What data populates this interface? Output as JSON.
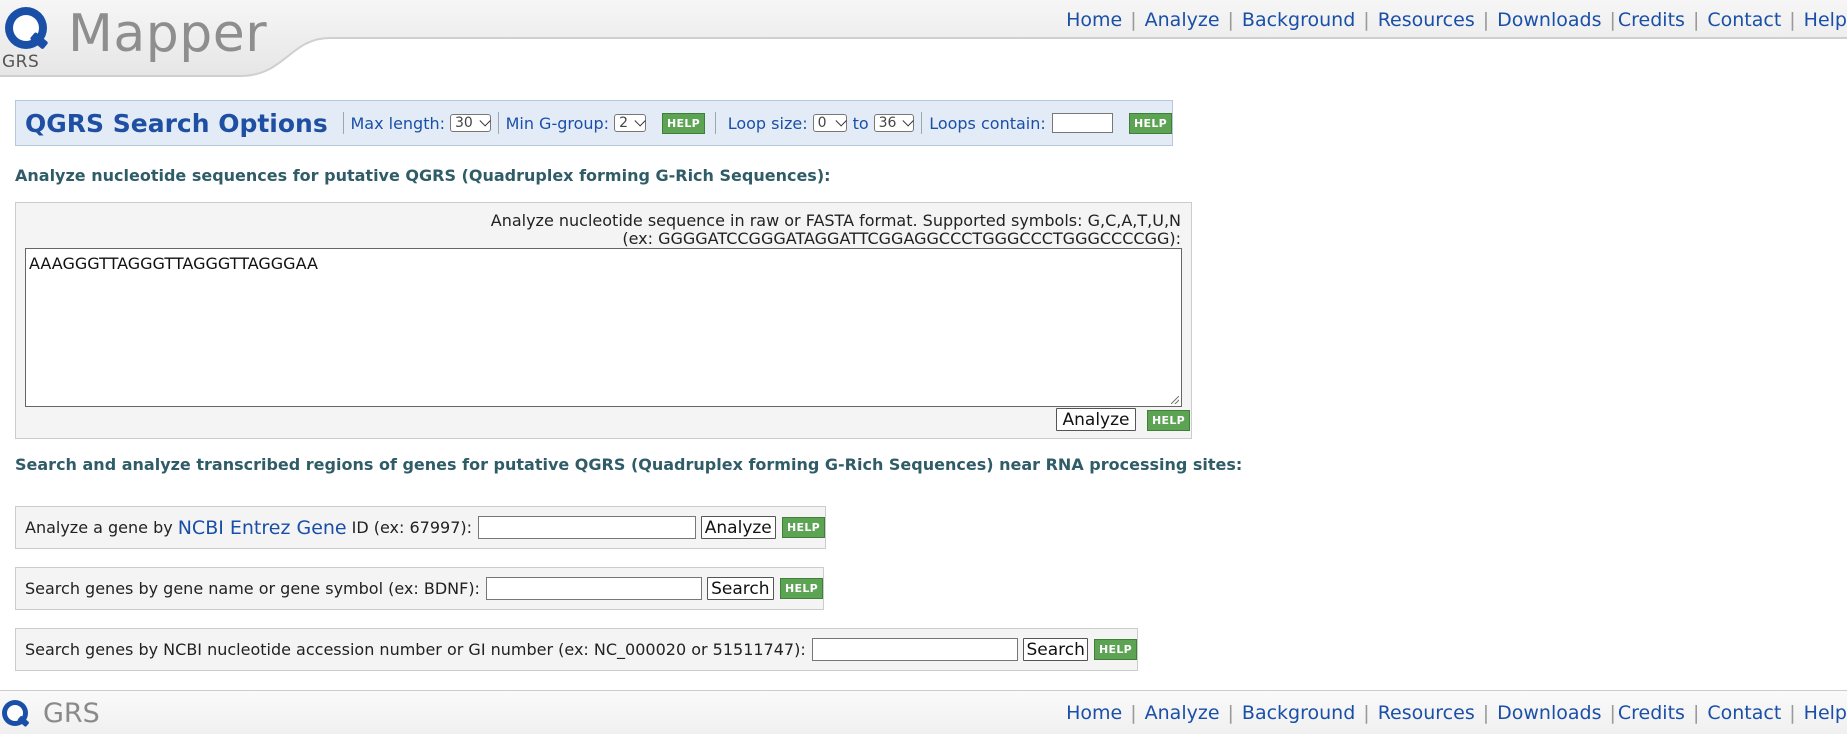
{
  "header": {
    "logo_text": "GRS",
    "app_name": "Mapper",
    "nav": [
      "Home",
      "Analyze",
      "Background",
      "Resources",
      "Downloads",
      "Credits",
      "Contact",
      "Help"
    ]
  },
  "options": {
    "title": "QGRS Search Options",
    "max_length_label": "Max length:",
    "max_length_value": "30",
    "min_ggroup_label": "Min G-group:",
    "min_ggroup_value": "2",
    "help_label": "HELP",
    "loop_size_label": "Loop size:",
    "loop_min_value": "0",
    "loop_to_label": "to",
    "loop_max_value": "36",
    "loops_contain_label": "Loops contain:",
    "loops_contain_value": ""
  },
  "analyze_section": {
    "heading": "Analyze nucleotide sequences for putative QGRS (Quadruplex forming G-Rich Sequences):",
    "hint_line1": "Analyze nucleotide sequence in raw or FASTA format. Supported symbols: G,C,A,T,U,N",
    "hint_line2": "(ex: GGGGATCCGGGATAGGATTCGGAGGCCCTGGGCCCTGGGCCCCGG):",
    "sequence_value": "AAAGGGTTAGGGTTAGGGTTAGGGAA",
    "analyze_button": "Analyze",
    "help_label": "HELP"
  },
  "genes_section": {
    "heading": "Search and analyze transcribed regions of genes for putative QGRS (Quadruplex forming G-Rich Sequences) near RNA processing sites:",
    "entrez": {
      "prefix": "Analyze a gene by",
      "link": "NCBI Entrez Gene",
      "suffix": "ID (ex: 67997):",
      "value": "",
      "button": "Analyze"
    },
    "by_name": {
      "label": "Search genes by gene name or gene symbol (ex: BDNF):",
      "value": "",
      "button": "Search"
    },
    "by_accession": {
      "label": "Search genes by NCBI nucleotide accession number or GI number (ex: NC_000020 or 51511747):",
      "value": "",
      "button": "Search"
    },
    "help_label": "HELP"
  },
  "footer": {
    "logo_text": "GRS",
    "nav": [
      "Home",
      "Analyze",
      "Background",
      "Resources",
      "Downloads",
      "Credits",
      "Contact",
      "Help"
    ]
  }
}
